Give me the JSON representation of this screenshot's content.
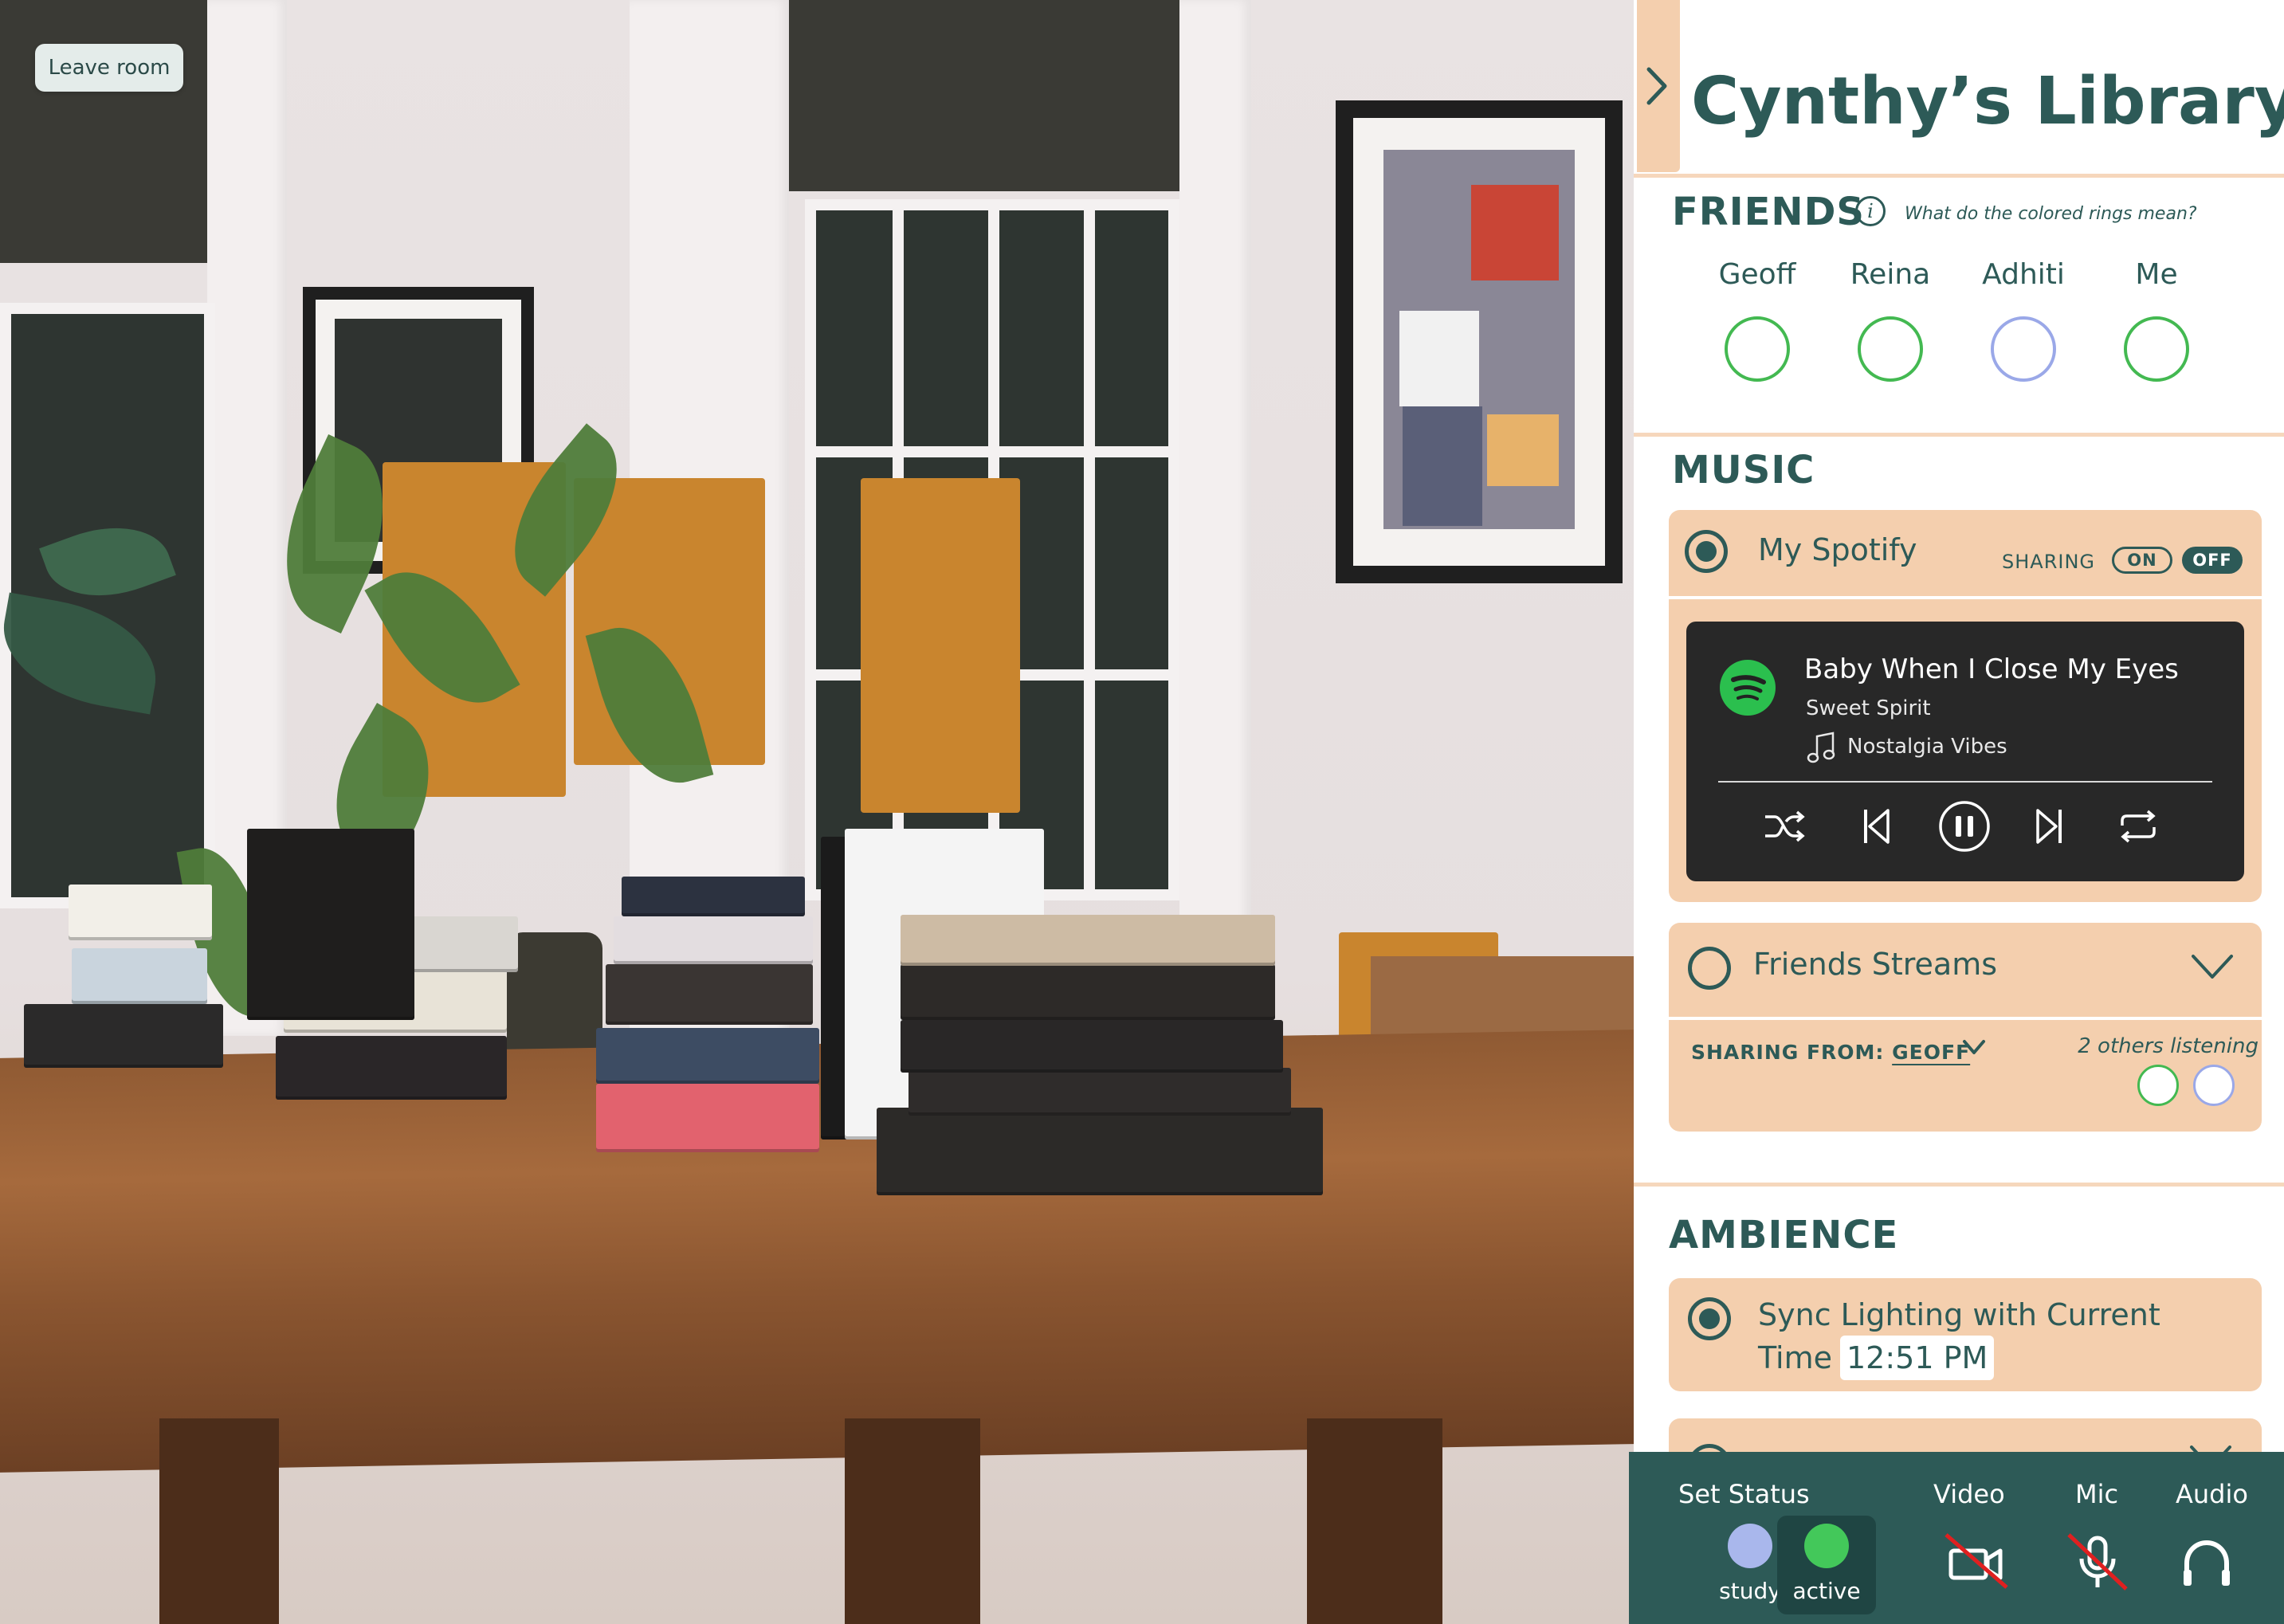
{
  "room": {
    "leave_label": "Leave room"
  },
  "sidebar": {
    "title": "Cynthy’s Library",
    "friends": {
      "heading": "FRIENDS",
      "rings_question": "What do the colored rings mean?",
      "list": [
        {
          "name": "Geoff",
          "ring_color": "#43b951"
        },
        {
          "name": "Reina",
          "ring_color": "#43b951"
        },
        {
          "name": "Adhiti",
          "ring_color": "#9aa8e8"
        },
        {
          "name": "Me",
          "ring_color": "#43b951"
        }
      ]
    },
    "music": {
      "heading": "MUSIC",
      "my_spotify": {
        "label": "My Spotify",
        "selected": true,
        "sharing_label": "SHARING",
        "toggle_on": "ON",
        "toggle_off": "OFF",
        "sharing_state": "off"
      },
      "player": {
        "song": "Baby When I Close My Eyes",
        "artist": "Sweet Spirit",
        "playlist": "Nostalgia Vibes",
        "state": "playing"
      },
      "friends_streams": {
        "label": "Friends Streams",
        "selected": false,
        "sharing_from_label": "SHARING FROM:",
        "sharing_from_value": "GEOFF",
        "others_listening": "2 others listening",
        "listener_ring_colors": [
          "#43b951",
          "#9aa8e8"
        ]
      }
    },
    "ambience": {
      "heading": "AMBIENCE",
      "sync_lighting": {
        "label_line1": "Sync Lighting with Current",
        "label_line2": "Time",
        "time": "12:51 PM",
        "selected": true
      }
    }
  },
  "bottom_bar": {
    "set_status_label": "Set Status",
    "statuses": [
      {
        "label": "study",
        "color": "#a9b7ec",
        "selected": false
      },
      {
        "label": "active",
        "color": "#43c85a",
        "selected": true
      }
    ],
    "video_label": "Video",
    "mic_label": "Mic",
    "audio_label": "Audio",
    "video_enabled": false,
    "mic_enabled": false
  },
  "colors": {
    "teal": "#2d5a57",
    "peach": "#f4cfae",
    "spotify_green": "#2bbf4e",
    "mute_red": "#e02020"
  }
}
